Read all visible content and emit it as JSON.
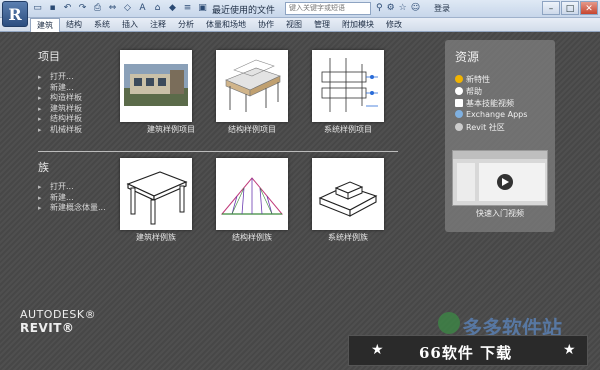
{
  "titlebar": {
    "title": "最近使用的文件",
    "search_placeholder": "键入关键字或短语",
    "login": "登录"
  },
  "ribbon": {
    "tabs": [
      "建筑",
      "结构",
      "系统",
      "插入",
      "注释",
      "分析",
      "体量和场地",
      "协作",
      "视图",
      "管理",
      "附加模块",
      "修改"
    ]
  },
  "projects": {
    "title": "项目",
    "links": [
      "打开...",
      "新建...",
      "构造样板",
      "建筑样板",
      "结构样板",
      "机械样板"
    ],
    "cards": [
      {
        "label": "建筑样例项目",
        "icon": "building-render-icon"
      },
      {
        "label": "结构样例项目",
        "icon": "structure-model-icon"
      },
      {
        "label": "系统样例项目",
        "icon": "mep-system-icon"
      }
    ]
  },
  "families": {
    "title": "族",
    "links": [
      "打开...",
      "新建...",
      "新建概念体量..."
    ],
    "cards": [
      {
        "label": "建筑样例族",
        "icon": "table-icon"
      },
      {
        "label": "结构样例族",
        "icon": "truss-icon"
      },
      {
        "label": "系统样例族",
        "icon": "equipment-box-icon"
      }
    ]
  },
  "resources": {
    "title": "资源",
    "items": [
      {
        "label": "新特性",
        "icon": "star-bulb-icon",
        "color": "#f2b400"
      },
      {
        "label": "帮助",
        "icon": "help-icon",
        "color": "#ffffff"
      },
      {
        "label": "基本技能视频",
        "icon": "video-icon",
        "color": "#ffffff"
      },
      {
        "label": "Exchange Apps",
        "icon": "exchange-icon",
        "color": "#7fb0e0"
      },
      {
        "label": "Revit 社区",
        "icon": "community-icon",
        "color": "#cccccc"
      }
    ],
    "video_label": "快速入门视频"
  },
  "brand": {
    "line1": "AUTODESK®",
    "line2": "REVIT®"
  },
  "watermark": {
    "text": "66软件 下载",
    "logo_text": "多多软件站"
  }
}
